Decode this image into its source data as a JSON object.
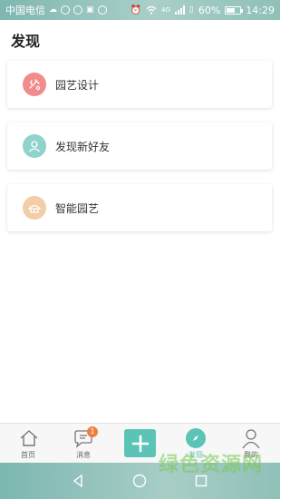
{
  "status_bar": {
    "carrier": "中国电信",
    "battery": "60%",
    "time": "14:29",
    "network": "4G"
  },
  "header": {
    "title": "发现"
  },
  "cards": [
    {
      "label": "园艺设计",
      "icon": "garden-design-icon",
      "color": "#f28b8b"
    },
    {
      "label": "发现新好友",
      "icon": "find-friend-icon",
      "color": "#8fd3cc"
    },
    {
      "label": "智能园艺",
      "icon": "smart-garden-icon",
      "color": "#f2cda7"
    }
  ],
  "bottom_nav": {
    "home": "首页",
    "messages": "消息",
    "messages_badge": "1",
    "discover": "发现",
    "mine": "我的",
    "accent": "#5cc4b7"
  },
  "watermark": "绿色资源网"
}
